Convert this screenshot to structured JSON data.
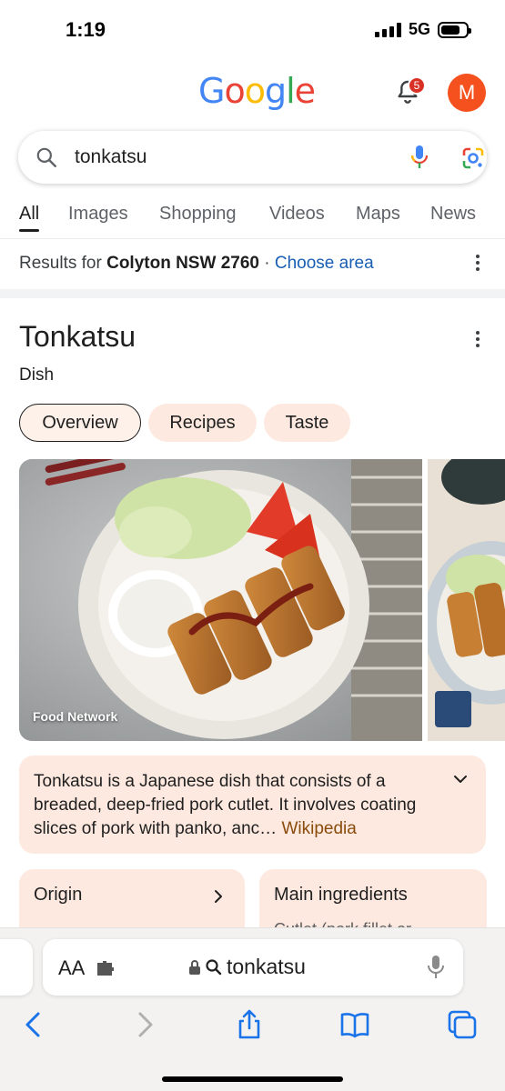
{
  "status": {
    "time": "1:19",
    "network": "5G",
    "battery_level": 0.75
  },
  "header": {
    "logo": "Google",
    "notification_count": "5",
    "avatar_initial": "M"
  },
  "search": {
    "query": "tonkatsu"
  },
  "tabs": [
    "All",
    "Images",
    "Shopping",
    "Videos",
    "Maps",
    "News"
  ],
  "location": {
    "prefix": "Results for",
    "place": "Colyton NSW 2760",
    "dot": " · ",
    "link": "Choose area"
  },
  "knowledge_panel": {
    "title": "Tonkatsu",
    "subtitle": "Dish",
    "chips": [
      "Overview",
      "Recipes",
      "Taste"
    ],
    "image_credit": "Food Network",
    "description": "Tonkatsu is a Japanese dish that consists of a breaded, deep-fried pork cutlet. It involves coating slices of pork with panko, anc…",
    "description_source": "Wikipedia",
    "cards": [
      {
        "title": "Origin",
        "value": ""
      },
      {
        "title": "Main ingredients",
        "value": "Cutlet (pork fillet or"
      }
    ]
  },
  "safari": {
    "text_size": "AA",
    "url": "tonkatsu"
  },
  "colors": {
    "accent_blue": "#1a5fb4",
    "panel_peach": "#fde9df",
    "avatar": "#f4511e",
    "badge": "#d93025"
  }
}
